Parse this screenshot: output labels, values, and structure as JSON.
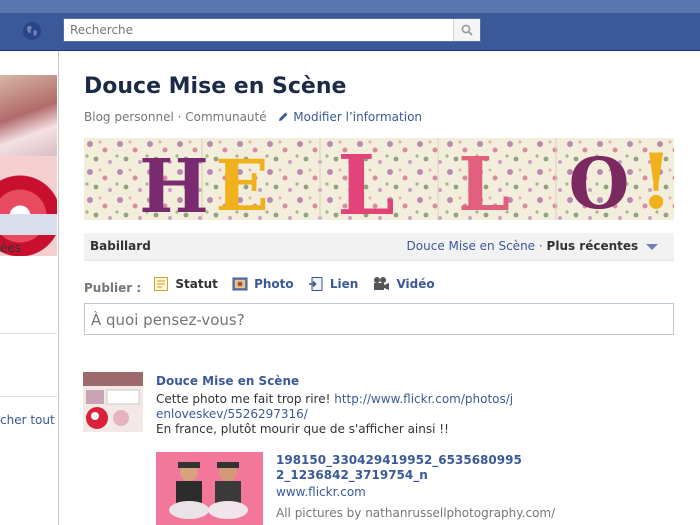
{
  "search": {
    "placeholder": "Recherche"
  },
  "left": {
    "item_text": "ées",
    "link_text": "cher tout"
  },
  "page": {
    "title": "Douce Mise en Scène",
    "category": "Blog personnel",
    "community": "Communauté",
    "edit_info": "Modifier l’information"
  },
  "banner": {
    "letters": [
      "H",
      "E",
      "L",
      "L",
      "O",
      "!"
    ],
    "letter_colors": [
      "#7a2a6e",
      "#f1b11d",
      "#e2447a",
      "#e0607d",
      "#7b2a61",
      "#f1b11d"
    ]
  },
  "wall": {
    "label": "Babillard",
    "filter_owner": "Douce Mise en Scène",
    "sort": "Plus récentes"
  },
  "publish": {
    "label": "Publier :",
    "tabs": [
      {
        "label": "Statut",
        "icon": "status-icon"
      },
      {
        "label": "Photo",
        "icon": "photo-icon"
      },
      {
        "label": "Lien",
        "icon": "link-icon"
      },
      {
        "label": "Vidéo",
        "icon": "video-icon"
      }
    ],
    "placeholder": "À quoi pensez-vous?"
  },
  "post": {
    "author": "Douce Mise en Scène",
    "text_prefix": "Cette photo me fait trop rire! ",
    "link": "http://www.flickr.com/photos/jenloveskev/5526297316/",
    "text_suffix": "En france, plutôt mourir que de s'afficher ainsi !!",
    "attachment": {
      "title": "198150_330429419952_65356809952_1236842_3719754_n",
      "url": "www.flickr.com",
      "desc": "All pictures by nathanrussellphotography.com/"
    }
  },
  "colors": {
    "brand": "#3b5998",
    "title": "#1c2a47"
  }
}
